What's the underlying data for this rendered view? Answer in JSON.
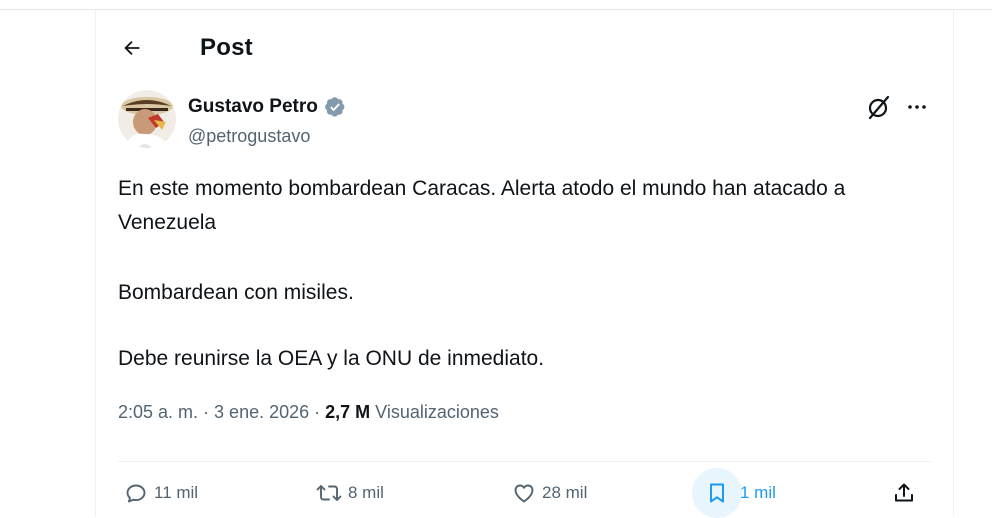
{
  "header": {
    "title": "Post"
  },
  "author": {
    "name": "Gustavo Petro",
    "handle": "@petrogustavo",
    "verified_color": "#829aab"
  },
  "tweet": {
    "paragraphs": [
      "En este momento bombardean Caracas. Alerta atodo el mundo han atacado a Venezuela",
      "Bombardean con misiles.",
      "Debe reunirse la OEA y la ONU de inmediato."
    ]
  },
  "meta": {
    "time": "2:05 a. m.",
    "sep1": " · ",
    "date": "3 ene. 2026",
    "sep2": " · ",
    "views": "2,7 M",
    "views_label": " Visualizaciones"
  },
  "actions": {
    "replies": "11 mil",
    "reposts": "8 mil",
    "likes": "28 mil",
    "bookmarks": "1 mil"
  },
  "icons": [
    "back-arrow-icon",
    "verified-badge-icon",
    "grok-icon",
    "more-icon",
    "reply-icon",
    "repost-icon",
    "like-icon",
    "bookmark-icon",
    "share-icon"
  ],
  "colors": {
    "text": "#0f1419",
    "secondary": "#536471",
    "accent": "#1d9bf0",
    "bookmark_bg": "#e8f5fd",
    "border": "#eff3f4"
  }
}
